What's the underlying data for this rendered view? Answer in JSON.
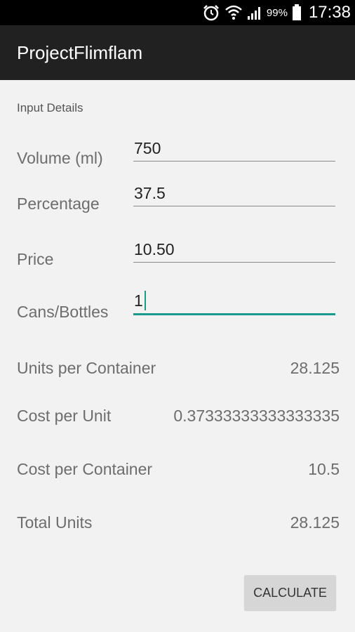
{
  "status_bar": {
    "battery_percent": "99%",
    "time": "17:38",
    "icons": [
      "alarm-icon",
      "wifi-icon",
      "signal-icon",
      "battery-icon"
    ]
  },
  "app_bar": {
    "title": "ProjectFlimflam"
  },
  "form": {
    "section_label": "Input Details",
    "volume": {
      "label": "Volume (ml)",
      "value": "750"
    },
    "percentage": {
      "label": "Percentage",
      "value": "37.5"
    },
    "price": {
      "label": "Price",
      "value": "10.50"
    },
    "cans": {
      "label": "Cans/Bottles",
      "value": "1"
    }
  },
  "results": {
    "units_per_container": {
      "label": "Units per Container",
      "value": "28.125"
    },
    "cost_per_unit": {
      "label": "Cost per Unit",
      "value": "0.37333333333333335"
    },
    "cost_per_container": {
      "label": "Cost per Container",
      "value": "10.5"
    },
    "total_units": {
      "label": "Total Units",
      "value": "28.125"
    }
  },
  "actions": {
    "calculate_label": "CALCULATE"
  },
  "colors": {
    "accent": "#1a9a8c",
    "app_bar": "#212121",
    "background": "#f2f2f2"
  }
}
